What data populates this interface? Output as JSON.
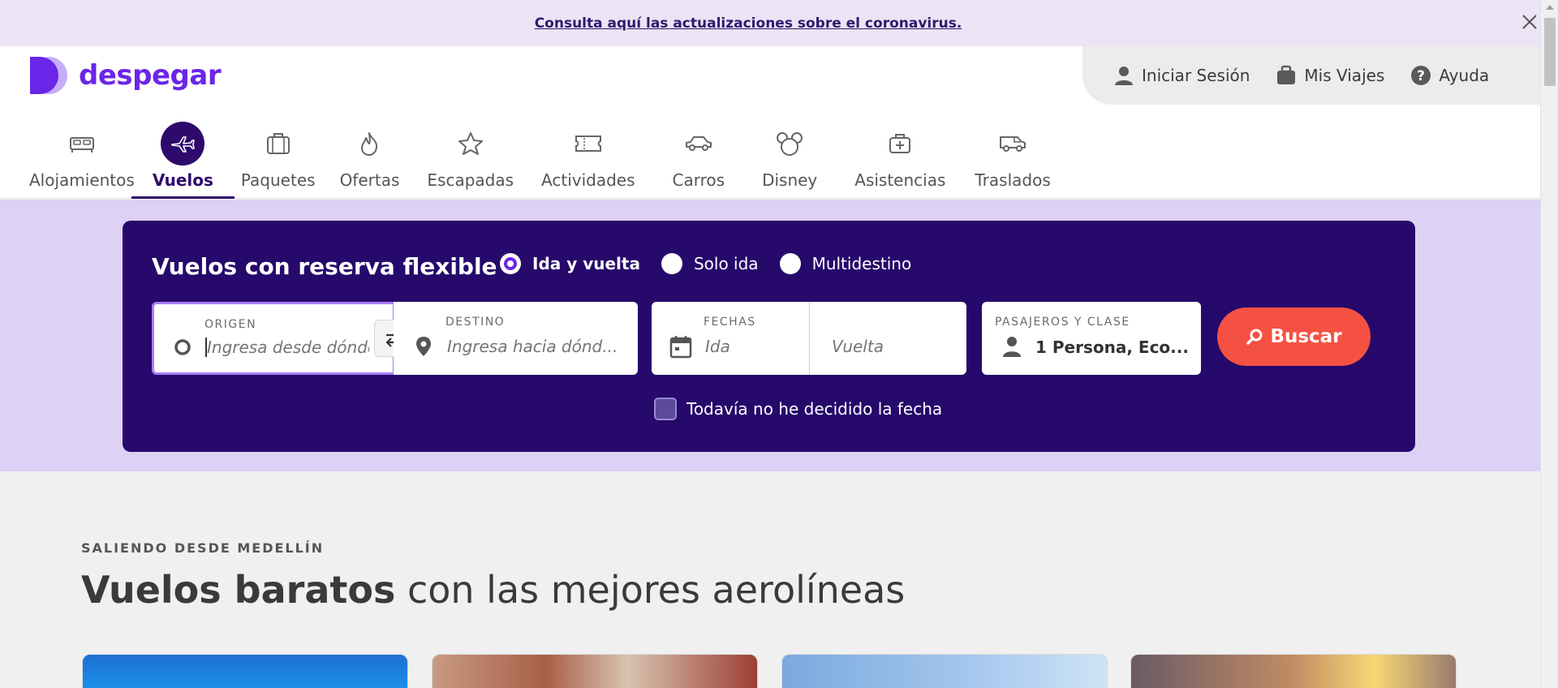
{
  "banner": {
    "link_text": "Consulta aquí las actualizaciones sobre el coronavirus."
  },
  "brand": {
    "name": "despegar",
    "color": "#6b25e8",
    "dark_color": "#26096b",
    "accent": "#f55143"
  },
  "user_menu": {
    "items": [
      {
        "label": "Iniciar Sesión",
        "icon": "user-icon"
      },
      {
        "label": "Mis Viajes",
        "icon": "suitcase-icon"
      },
      {
        "label": "Ayuda",
        "icon": "help-icon"
      }
    ]
  },
  "nav": {
    "items": [
      {
        "label": "Alojamientos",
        "icon": "bed-icon"
      },
      {
        "label": "Vuelos",
        "icon": "plane-icon",
        "active": true
      },
      {
        "label": "Paquetes",
        "icon": "luggage-icon"
      },
      {
        "label": "Ofertas",
        "icon": "flame-icon"
      },
      {
        "label": "Escapadas",
        "icon": "star-icon"
      },
      {
        "label": "Actividades",
        "icon": "ticket-icon"
      },
      {
        "label": "Carros",
        "icon": "car-icon"
      },
      {
        "label": "Disney",
        "icon": "mickey-icon"
      },
      {
        "label": "Asistencias",
        "icon": "medical-bag-icon"
      },
      {
        "label": "Traslados",
        "icon": "van-icon"
      }
    ]
  },
  "search": {
    "title": "Vuelos con reserva flexible",
    "trip_types": [
      {
        "label": "Ida y vuelta",
        "selected": true
      },
      {
        "label": "Solo ida",
        "selected": false
      },
      {
        "label": "Multidestino",
        "selected": false
      }
    ],
    "origin": {
      "label": "ORIGEN",
      "placeholder": "Ingresa desde dónde"
    },
    "destination": {
      "label": "DESTINO",
      "placeholder": "Ingresa hacia dónd..."
    },
    "dates": {
      "label": "FECHAS",
      "depart_placeholder": "Ida",
      "return_placeholder": "Vuelta"
    },
    "passengers": {
      "label": "PASAJEROS Y CLASE",
      "value": "1 Persona, Eco..."
    },
    "button_label": "Buscar",
    "undecided_label": "Todavía no he decidido la fecha"
  },
  "section": {
    "kicker": "SALIENDO DESDE MEDELLÍN",
    "title_bold": "Vuelos baratos",
    "title_rest": " con las mejores aerolíneas"
  }
}
